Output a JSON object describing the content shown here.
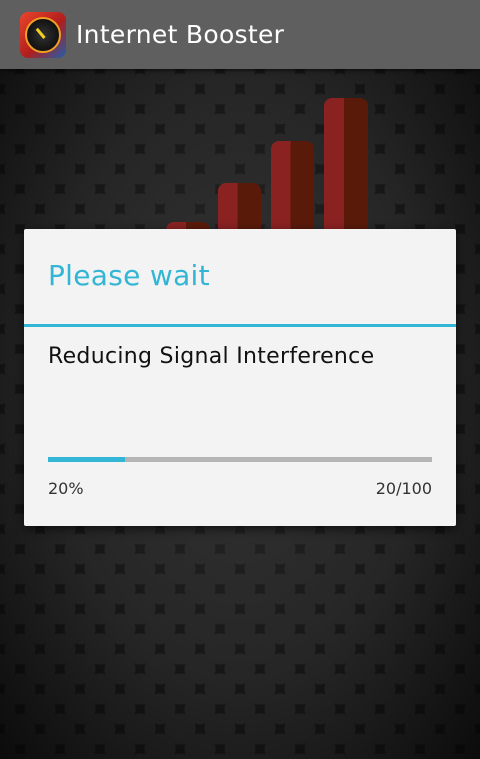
{
  "app": {
    "title": "Internet Booster",
    "icon": "speedometer-icon"
  },
  "dialog": {
    "title": "Please wait",
    "message": "Reducing Signal Interference",
    "progress": {
      "value": 20,
      "max": 100,
      "fraction": 0.2,
      "percent_label": "20%",
      "count_label": "20/100"
    }
  },
  "colors": {
    "accent": "#33b5d5",
    "action_bar": "#5f5f5f",
    "dialog_bg": "#f3f3f3",
    "bar_red": "#8a2222"
  }
}
